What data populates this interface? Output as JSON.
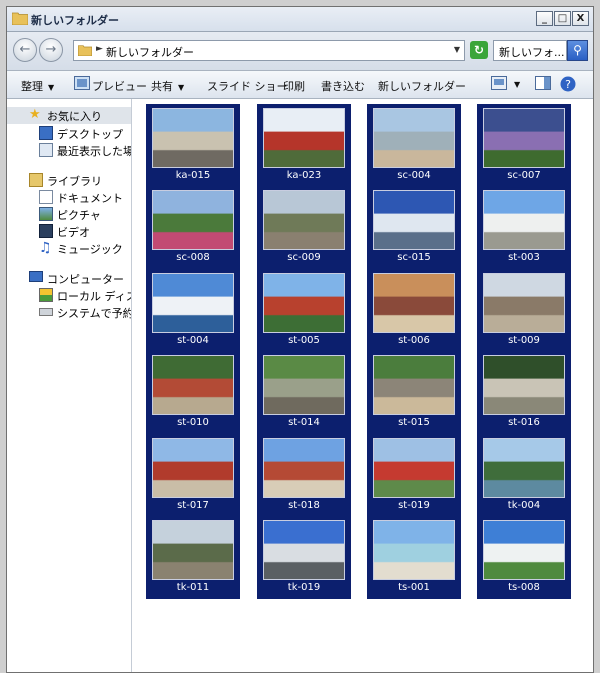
{
  "window": {
    "title": "新しいフォルダー"
  },
  "window_buttons": {
    "minimize": "_",
    "maximize": "□",
    "close": "X"
  },
  "address": {
    "path": "新しいフォルダー"
  },
  "search": {
    "placeholder": "新しいフォ..."
  },
  "toolbar": {
    "organize": "整理",
    "preview": "プレビュー",
    "share": "共有",
    "slideshow": "スライド ショー",
    "print": "印刷",
    "burn": "書き込む",
    "new_folder": "新しいフォルダー"
  },
  "nav": {
    "favorites": "お気に入り",
    "desktop": "デスクトップ",
    "recent": "最近表示した場所",
    "libraries": "ライブラリ",
    "documents": "ドキュメント",
    "pictures": "ピクチャ",
    "videos": "ビデオ",
    "music": "ミュージック",
    "computer": "コンピューター",
    "local_disk": "ローカル ディスク",
    "system_reserved": "システムで予約済み"
  },
  "files": [
    {
      "name": "ka-015",
      "colors": [
        "#8cb6e0",
        "#c9c2b0",
        "#6f6a62"
      ]
    },
    {
      "name": "ka-023",
      "colors": [
        "#e8eef5",
        "#b5352a",
        "#4f6b3a"
      ]
    },
    {
      "name": "sc-004",
      "colors": [
        "#a9c6e2",
        "#9fb0b9",
        "#c9b79c"
      ]
    },
    {
      "name": "sc-007",
      "colors": [
        "#3c4f8f",
        "#8a6fb2",
        "#3e6b2f"
      ]
    },
    {
      "name": "sc-008",
      "colors": [
        "#8fb3de",
        "#4b7a3b",
        "#c24a73"
      ]
    },
    {
      "name": "sc-009",
      "colors": [
        "#b8c7d6",
        "#6f7a58",
        "#8a8070"
      ]
    },
    {
      "name": "sc-015",
      "colors": [
        "#2d57b3",
        "#dfe7f0",
        "#5a6f8a"
      ]
    },
    {
      "name": "st-003",
      "colors": [
        "#6ea6e6",
        "#eef0ef",
        "#9a9a90"
      ]
    },
    {
      "name": "st-004",
      "colors": [
        "#4f8ad6",
        "#eef2f6",
        "#2d5f9a"
      ]
    },
    {
      "name": "st-005",
      "colors": [
        "#7fb3e8",
        "#b8412e",
        "#3d6e35"
      ]
    },
    {
      "name": "st-006",
      "colors": [
        "#c98f5b",
        "#8a4a3a",
        "#d8c7a8"
      ]
    },
    {
      "name": "st-009",
      "colors": [
        "#cfd8e2",
        "#8a7a68",
        "#b9ad98"
      ]
    },
    {
      "name": "st-010",
      "colors": [
        "#3f6b34",
        "#b34b36",
        "#b7a98f"
      ]
    },
    {
      "name": "st-014",
      "colors": [
        "#5a8a45",
        "#9aa08a",
        "#6f6a5e"
      ]
    },
    {
      "name": "st-015",
      "colors": [
        "#4b7d3d",
        "#8c8578",
        "#cbb99a"
      ]
    },
    {
      "name": "st-016",
      "colors": [
        "#2f4f2a",
        "#c9c4b6",
        "#8a8878"
      ]
    },
    {
      "name": "st-017",
      "colors": [
        "#8fb8e6",
        "#b13b2c",
        "#c9bda7"
      ]
    },
    {
      "name": "st-018",
      "colors": [
        "#6ea2e2",
        "#b54a35",
        "#d8cdb7"
      ]
    },
    {
      "name": "st-019",
      "colors": [
        "#9ec0e4",
        "#c53a30",
        "#5e8a4a"
      ]
    },
    {
      "name": "tk-004",
      "colors": [
        "#a6c9e8",
        "#3f6d3b",
        "#5d8aa0"
      ]
    },
    {
      "name": "tk-011",
      "colors": [
        "#c5d1dc",
        "#5b6b4a",
        "#8a8270"
      ]
    },
    {
      "name": "tk-019",
      "colors": [
        "#3a6fd0",
        "#d9dde2",
        "#5a5f63"
      ]
    },
    {
      "name": "ts-001",
      "colors": [
        "#7fb3e8",
        "#9fd0e0",
        "#e3ddcf"
      ]
    },
    {
      "name": "ts-008",
      "colors": [
        "#3e7fd6",
        "#eef2f2",
        "#4f8a3e"
      ]
    }
  ]
}
